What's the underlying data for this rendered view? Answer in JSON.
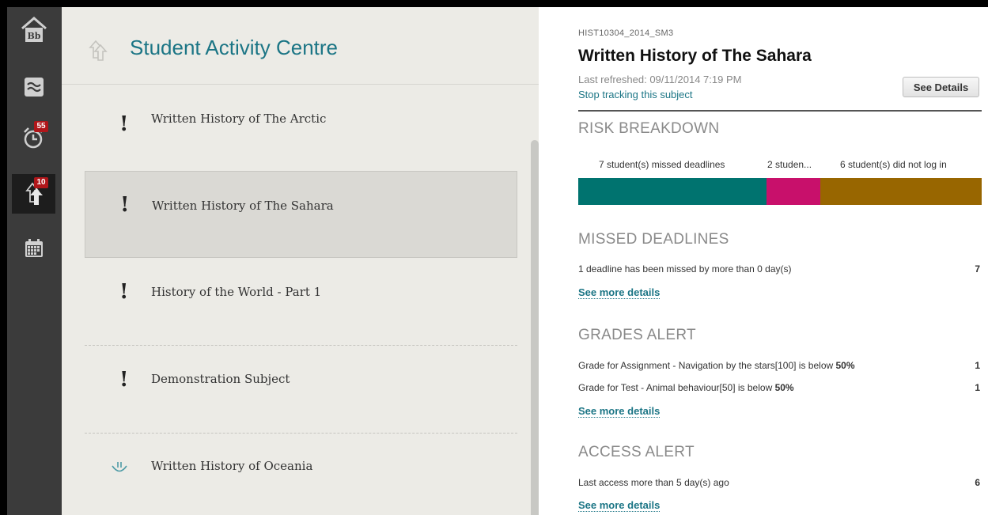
{
  "rail": {
    "tasks_badge": "55",
    "alerts_badge": "10"
  },
  "list": {
    "title": "Student Activity Centre",
    "subjects": [
      {
        "name": "Written History of The Arctic",
        "status": "!"
      },
      {
        "name": "Written History of The Sahara",
        "status": "!"
      },
      {
        "name": "History of the World - Part 1",
        "status": "!"
      },
      {
        "name": "Demonstration Subject",
        "status": "!"
      },
      {
        "name": "Written History of Oceania",
        "status": "ok"
      }
    ]
  },
  "detail": {
    "code": "HIST10304_2014_SM3",
    "title": "Written History of The Sahara",
    "refreshed": "Last refreshed: 09/11/2014 7:19 PM",
    "stop_tracking": "Stop tracking this subject",
    "see_details": "See Details",
    "risk": {
      "heading": "RISK BREAKDOWN",
      "segments": [
        {
          "label": "7 student(s) missed deadlines",
          "value": 7,
          "color": "#00736f"
        },
        {
          "label": "2 studen...",
          "value": 2,
          "color": "#c8106b"
        },
        {
          "label": "6 student(s) did not log in",
          "value": 6,
          "color": "#986600"
        }
      ]
    },
    "missed": {
      "heading": "MISSED DEADLINES",
      "rows": [
        {
          "text": "1 deadline has been missed by more than 0 day(s)",
          "count": "7"
        }
      ],
      "more": "See more details"
    },
    "grades": {
      "heading": "GRADES ALERT",
      "rows": [
        {
          "text": "Grade for Assignment - Navigation by the stars[100] is below ",
          "bold": "50%",
          "count": "1"
        },
        {
          "text": "Grade for Test - Animal behaviour[50] is below ",
          "bold": "50%",
          "count": "1"
        }
      ],
      "more": "See more details"
    },
    "access": {
      "heading": "ACCESS ALERT",
      "rows": [
        {
          "text": "Last access more than 5 day(s) ago",
          "count": "6"
        }
      ],
      "more": "See more details"
    }
  }
}
